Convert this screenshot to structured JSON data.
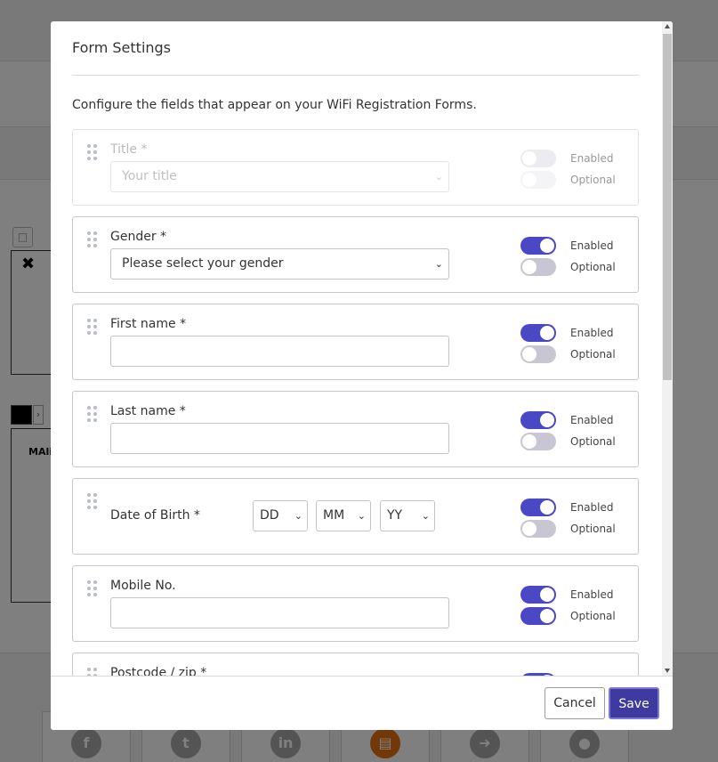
{
  "modal": {
    "title": "Form Settings",
    "intro": "Configure the fields that appear on your WiFi Registration Forms."
  },
  "toggle_labels": {
    "enabled": "Enabled",
    "optional": "Optional"
  },
  "fields": [
    {
      "label": "Title *",
      "control": "select",
      "value": "Your title",
      "enabled": false,
      "optional": false
    },
    {
      "label": "Gender *",
      "control": "select",
      "value": "Please select your gender",
      "enabled": true,
      "optional": false
    },
    {
      "label": "First name *",
      "control": "text",
      "value": "",
      "enabled": true,
      "optional": false
    },
    {
      "label": "Last name *",
      "control": "text",
      "value": "",
      "enabled": true,
      "optional": false
    },
    {
      "label": "Date of Birth *",
      "control": "date",
      "day": "DD",
      "month": "MM",
      "year": "YY",
      "enabled": true,
      "optional": false
    },
    {
      "label": "Mobile No.",
      "control": "text",
      "value": "",
      "enabled": true,
      "optional": true
    },
    {
      "label": "Postcode / zip *",
      "control": "text",
      "value": "",
      "enabled": true,
      "optional": false
    }
  ],
  "footer": {
    "cancel": "Cancel",
    "save": "Save"
  },
  "background": {
    "partial_text": "MAli"
  },
  "colors": {
    "accent": "#4b48c5",
    "save_button": "#3e3a9f",
    "toggle_off": "#c9c6d3"
  },
  "icons": [
    "lock-icon",
    "close-icon",
    "chevron-right-icon",
    "drag-handle-icon",
    "chevron-down-icon",
    "facebook-icon",
    "twitter-icon",
    "linkedin-icon",
    "form-icon",
    "arrow-right-icon",
    "apple-icon"
  ]
}
